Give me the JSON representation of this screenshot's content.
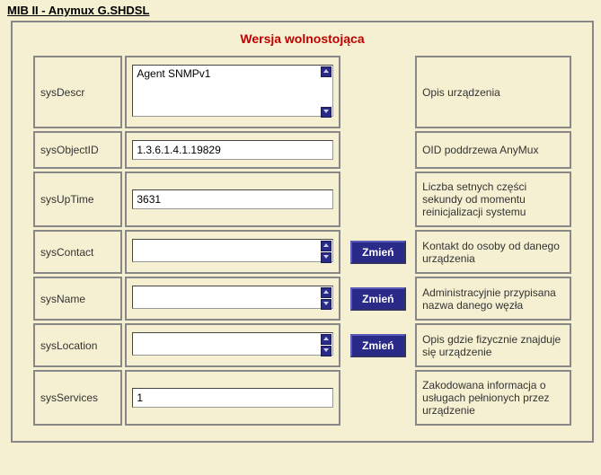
{
  "pageTitle": "MIB II - Anymux G.SHDSL",
  "sectionTitle": "Wersja wolnostojąca",
  "changeLabel": "Zmień",
  "rows": {
    "sysDescr": {
      "label": "sysDescr",
      "value": "Agent SNMPv1",
      "desc": "Opis urządzenia"
    },
    "sysObjectID": {
      "label": "sysObjectID",
      "value": "1.3.6.1.4.1.19829",
      "desc": "OID poddrzewa AnyMux"
    },
    "sysUpTime": {
      "label": "sysUpTime",
      "value": "3631",
      "desc": "Liczba setnych części sekundy od momentu reinicjalizacji systemu"
    },
    "sysContact": {
      "label": "sysContact",
      "value": "",
      "desc": "Kontakt do osoby od danego urządzenia"
    },
    "sysName": {
      "label": "sysName",
      "value": "",
      "desc": "Administracyjnie przypisana nazwa danego węzła"
    },
    "sysLocation": {
      "label": "sysLocation",
      "value": "",
      "desc": "Opis gdzie fizycznie znajduje się urządzenie"
    },
    "sysServices": {
      "label": "sysServices",
      "value": "1",
      "desc": "Zakodowana informacja o usługach pełnionych przez urządzenie"
    }
  }
}
